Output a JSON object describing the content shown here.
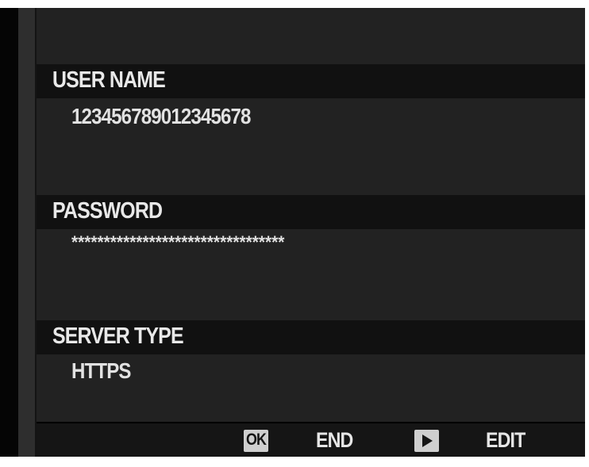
{
  "fields": [
    {
      "label": "USER NAME",
      "value": "123456789012345678"
    },
    {
      "label": "PASSWORD",
      "value": "*********************************"
    },
    {
      "label": "SERVER TYPE",
      "value": "HTTPS"
    }
  ],
  "footer": {
    "ok_icon_text": "OK",
    "end_label": "END",
    "edit_label": "EDIT"
  },
  "colors": {
    "background": "#222222",
    "header_band": "#111111",
    "text": "#e6e6e6",
    "icon_fill": "#cfcfcf"
  },
  "icons": {
    "ok_button": "ok-icon",
    "playback_button": "play-icon"
  }
}
